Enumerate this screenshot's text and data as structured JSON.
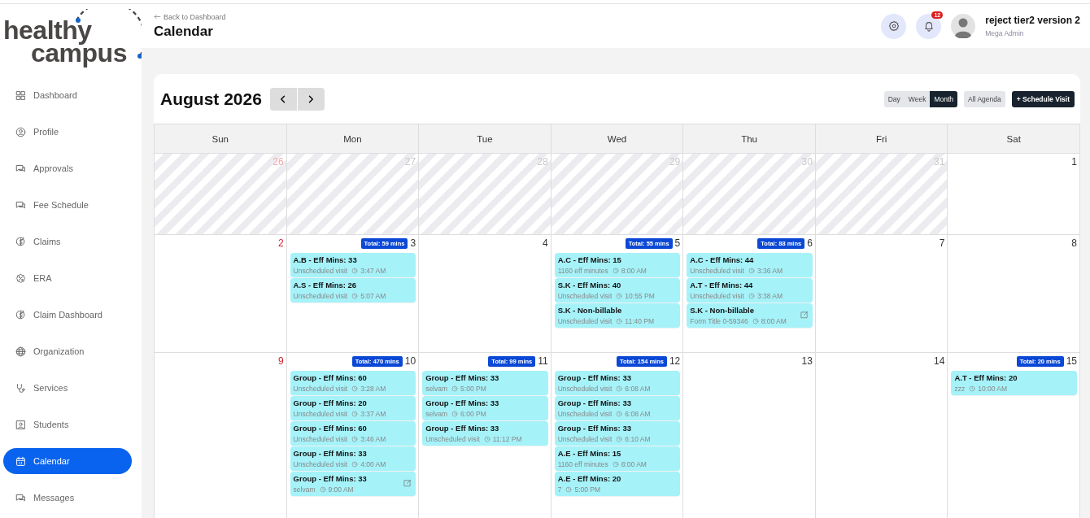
{
  "logo": {
    "line1": "healthy",
    "line2": "campus"
  },
  "sidebar": {
    "items": [
      {
        "label": "Dashboard",
        "selected": false
      },
      {
        "label": "Profile",
        "selected": false
      },
      {
        "label": "Approvals",
        "selected": false
      },
      {
        "label": "Fee Schedule",
        "selected": false
      },
      {
        "label": "Claims",
        "selected": false
      },
      {
        "label": "ERA",
        "selected": false
      },
      {
        "label": "Claim Dashboard",
        "selected": false
      },
      {
        "label": "Organization",
        "selected": false
      },
      {
        "label": "Services",
        "selected": false
      },
      {
        "label": "Students",
        "selected": false
      },
      {
        "label": "Calendar",
        "selected": true
      },
      {
        "label": "Messages",
        "selected": false
      }
    ]
  },
  "header": {
    "back_link": "Back to Dashboard",
    "title": "Calendar",
    "notification_count": "12",
    "user_name": "reject tier2 version 2",
    "user_role": "Mega Admin"
  },
  "calendar": {
    "month_title": "August 2026",
    "views": [
      {
        "label": "Day",
        "selected": false
      },
      {
        "label": "Week",
        "selected": false
      },
      {
        "label": "Month",
        "selected": true
      }
    ],
    "all_agenda": "All Agenda",
    "schedule_button": "+ Schedule Visit",
    "weekdays": [
      "Sun",
      "Mon",
      "Tue",
      "Wed",
      "Thu",
      "Fri",
      "Sat"
    ],
    "weeks": [
      {
        "days": [
          {
            "date": "26",
            "outside": true
          },
          {
            "date": "27",
            "outside": true
          },
          {
            "date": "28",
            "outside": true
          },
          {
            "date": "29",
            "outside": true
          },
          {
            "date": "30",
            "outside": true
          },
          {
            "date": "31",
            "outside": true
          },
          {
            "date": "1",
            "outside": false
          }
        ]
      },
      {
        "days": [
          {
            "date": "2",
            "outside": false
          },
          {
            "date": "3",
            "outside": false,
            "total": "Total: 59 mins",
            "events": [
              {
                "title": "A.B - Eff Mins: 33",
                "subtitle": "Unscheduled visit",
                "time": "3:47 AM",
                "editable": false
              },
              {
                "title": "A.S - Eff Mins: 26",
                "subtitle": "Unscheduled visit",
                "time": "5:07 AM",
                "editable": false
              }
            ]
          },
          {
            "date": "4",
            "outside": false
          },
          {
            "date": "5",
            "outside": false,
            "total": "Total: 55 mins",
            "events": [
              {
                "title": "A.C - Eff Mins: 15",
                "subtitle": "1160 eff minutes",
                "time": "8:00 AM",
                "editable": false
              },
              {
                "title": "S.K - Eff Mins: 40",
                "subtitle": "Unscheduled visit",
                "time": "10:55 PM",
                "editable": false
              },
              {
                "title": "S.K - Non-billable",
                "subtitle": "Unscheduled visit",
                "time": "11:40 PM",
                "editable": false
              }
            ]
          },
          {
            "date": "6",
            "outside": false,
            "total": "Total: 88 mins",
            "events": [
              {
                "title": "A.C - Eff Mins: 44",
                "subtitle": "Unscheduled visit",
                "time": "3:36 AM",
                "editable": false
              },
              {
                "title": "A.T - Eff Mins: 44",
                "subtitle": "Unscheduled visit",
                "time": "3:38 AM",
                "editable": false
              },
              {
                "title": "S.K - Non-billable",
                "subtitle": "Form Title 0-59346",
                "time": "8:00 AM",
                "editable": true
              }
            ]
          },
          {
            "date": "7",
            "outside": false
          },
          {
            "date": "8",
            "outside": false
          }
        ]
      },
      {
        "days": [
          {
            "date": "9",
            "outside": false
          },
          {
            "date": "10",
            "outside": false,
            "total": "Total: 470 mins",
            "events": [
              {
                "title": "Group - Eff Mins: 60",
                "subtitle": "Unscheduled visit",
                "time": "3:28 AM",
                "editable": false
              },
              {
                "title": "Group - Eff Mins: 20",
                "subtitle": "Unscheduled visit",
                "time": "3:37 AM",
                "editable": false
              },
              {
                "title": "Group - Eff Mins: 60",
                "subtitle": "Unscheduled visit",
                "time": "3:46 AM",
                "editable": false
              },
              {
                "title": "Group - Eff Mins: 33",
                "subtitle": "Unscheduled visit",
                "time": "4:00 AM",
                "editable": false
              },
              {
                "title": "Group - Eff Mins: 33",
                "subtitle": "selvam",
                "time": "9:00 AM",
                "editable": true
              }
            ]
          },
          {
            "date": "11",
            "outside": false,
            "total": "Total: 99 mins",
            "events": [
              {
                "title": "Group - Eff Mins: 33",
                "subtitle": "selvam",
                "time": "5:00 PM",
                "editable": false
              },
              {
                "title": "Group - Eff Mins: 33",
                "subtitle": "selvam",
                "time": "6:00 PM",
                "editable": false
              },
              {
                "title": "Group - Eff Mins: 33",
                "subtitle": "Unscheduled visit",
                "time": "11:12 PM",
                "editable": false
              }
            ]
          },
          {
            "date": "12",
            "outside": false,
            "total": "Total: 154 mins",
            "events": [
              {
                "title": "Group - Eff Mins: 33",
                "subtitle": "Unscheduled visit",
                "time": "6:08 AM",
                "editable": false
              },
              {
                "title": "Group - Eff Mins: 33",
                "subtitle": "Unscheduled visit",
                "time": "6:08 AM",
                "editable": false
              },
              {
                "title": "Group - Eff Mins: 33",
                "subtitle": "Unscheduled visit",
                "time": "6:10 AM",
                "editable": false
              },
              {
                "title": "A.E - Eff Mins: 15",
                "subtitle": "1160 eff minutes",
                "time": "8:00 AM",
                "editable": false
              },
              {
                "title": "A.E - Eff Mins: 20",
                "subtitle": "7",
                "time": "5:00 PM",
                "editable": false
              }
            ]
          },
          {
            "date": "13",
            "outside": false
          },
          {
            "date": "14",
            "outside": false
          },
          {
            "date": "15",
            "outside": false,
            "total": "Total: 20 mins",
            "events": [
              {
                "title": "A.T - Eff Mins: 20",
                "subtitle": "zzz",
                "time": "10:00 AM",
                "editable": false
              }
            ]
          }
        ]
      }
    ]
  }
}
